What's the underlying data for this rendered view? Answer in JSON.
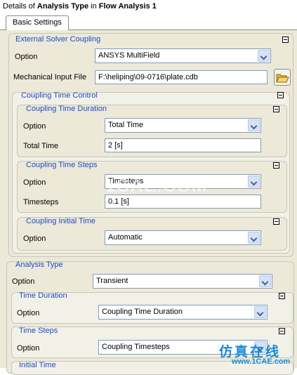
{
  "window": {
    "title_prefix": "Details of ",
    "title_object": "Analysis Type",
    "title_mid": " in ",
    "title_parent": "Flow Analysis 1"
  },
  "tabs": [
    {
      "label": "Basic Settings"
    }
  ],
  "external_solver": {
    "title": "External Solver Coupling",
    "option_label": "Option",
    "option_value": "ANSYS MultiField",
    "input_file_label": "Mechanical Input File",
    "input_file_value": "F:\\heliping\\09-0716\\plate.cdb",
    "coupling_time_control": {
      "title": "Coupling Time Control",
      "duration": {
        "title": "Coupling Time Duration",
        "option_label": "Option",
        "option_value": "Total Time",
        "total_time_label": "Total Time",
        "total_time_value": "2 [s]"
      },
      "time_steps": {
        "title": "Coupling Time Steps",
        "option_label": "Option",
        "option_value": "Timesteps",
        "timesteps_label": "Timesteps",
        "timesteps_value": "0.1 [s]"
      },
      "initial_time": {
        "title": "Coupling Initial Time",
        "option_label": "Option",
        "option_value": "Automatic"
      }
    }
  },
  "analysis_type": {
    "title": "Analysis Type",
    "option_label": "Option",
    "option_value": "Transient",
    "time_duration": {
      "title": "Time Duration",
      "option_label": "Option",
      "option_value": "Coupling Time Duration"
    },
    "time_steps": {
      "title": "Time Steps",
      "option_label": "Option",
      "option_value": "Coupling Timesteps"
    },
    "initial_time": {
      "title": "Initial Time"
    }
  },
  "watermark": {
    "center_text": "1CAE.COM",
    "logo_cn": "仿真在线",
    "logo_url": "www.1CAE.com"
  }
}
